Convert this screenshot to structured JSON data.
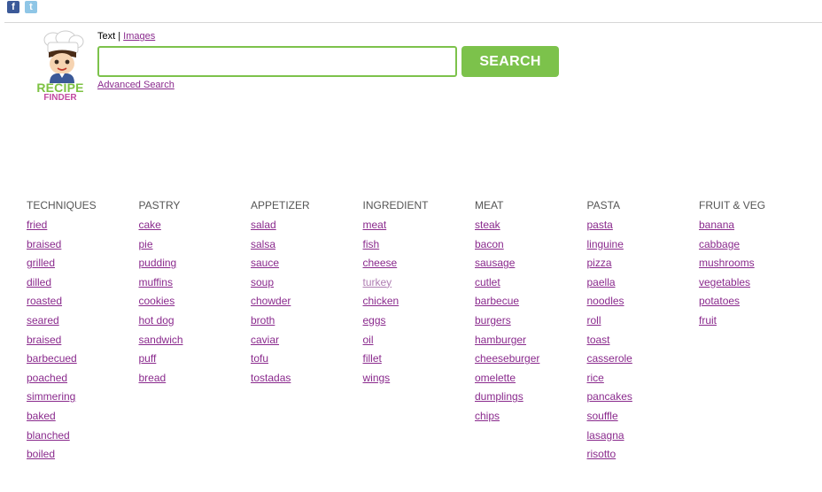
{
  "social": {
    "facebook": "f",
    "twitter": "t"
  },
  "logo": {
    "line1": "RECIPE",
    "line2": "FINDER"
  },
  "tabs": {
    "text": "Text",
    "separator": "|",
    "images": "Images"
  },
  "search": {
    "value": "",
    "placeholder": "",
    "button": "SEARCH",
    "advanced": "Advanced Search"
  },
  "categories": [
    {
      "title": "TECHNIQUES",
      "items": [
        "fried",
        "braised",
        "grilled",
        "dilled",
        "roasted",
        "seared",
        "braised",
        "barbecued",
        "poached",
        "simmering",
        "baked",
        "blanched",
        "boiled"
      ]
    },
    {
      "title": "PASTRY",
      "items": [
        "cake",
        "pie",
        "pudding",
        "muffins",
        "cookies",
        "hot dog",
        "sandwich",
        "puff",
        "bread"
      ]
    },
    {
      "title": "APPETIZER",
      "items": [
        "salad",
        "salsa",
        "sauce",
        "soup",
        "chowder",
        "broth",
        "caviar",
        "tofu",
        "tostadas"
      ]
    },
    {
      "title": "INGREDIENT",
      "items": [
        "meat",
        "fish",
        "cheese",
        "turkey",
        "chicken",
        "eggs",
        "oil",
        "fillet",
        "wings"
      ]
    },
    {
      "title": "MEAT",
      "items": [
        "steak",
        "bacon",
        "sausage",
        "cutlet",
        "barbecue",
        "burgers",
        "hamburger",
        "cheeseburger",
        "omelette",
        "dumplings",
        "chips"
      ]
    },
    {
      "title": "PASTA",
      "items": [
        "pasta",
        "linguine",
        "pizza",
        "paella",
        "noodles",
        "roll",
        "toast",
        "casserole",
        "rice",
        "pancakes",
        "souffle",
        "lasagna",
        "risotto"
      ]
    },
    {
      "title": "FRUIT & VEG",
      "items": [
        "banana",
        "cabbage",
        "mushrooms",
        "vegetables",
        "potatoes",
        "fruit"
      ]
    }
  ],
  "colors": {
    "accent_green": "#7cc24b",
    "link_purple": "#8a2a8d",
    "visited_link": "#b07fb3"
  }
}
